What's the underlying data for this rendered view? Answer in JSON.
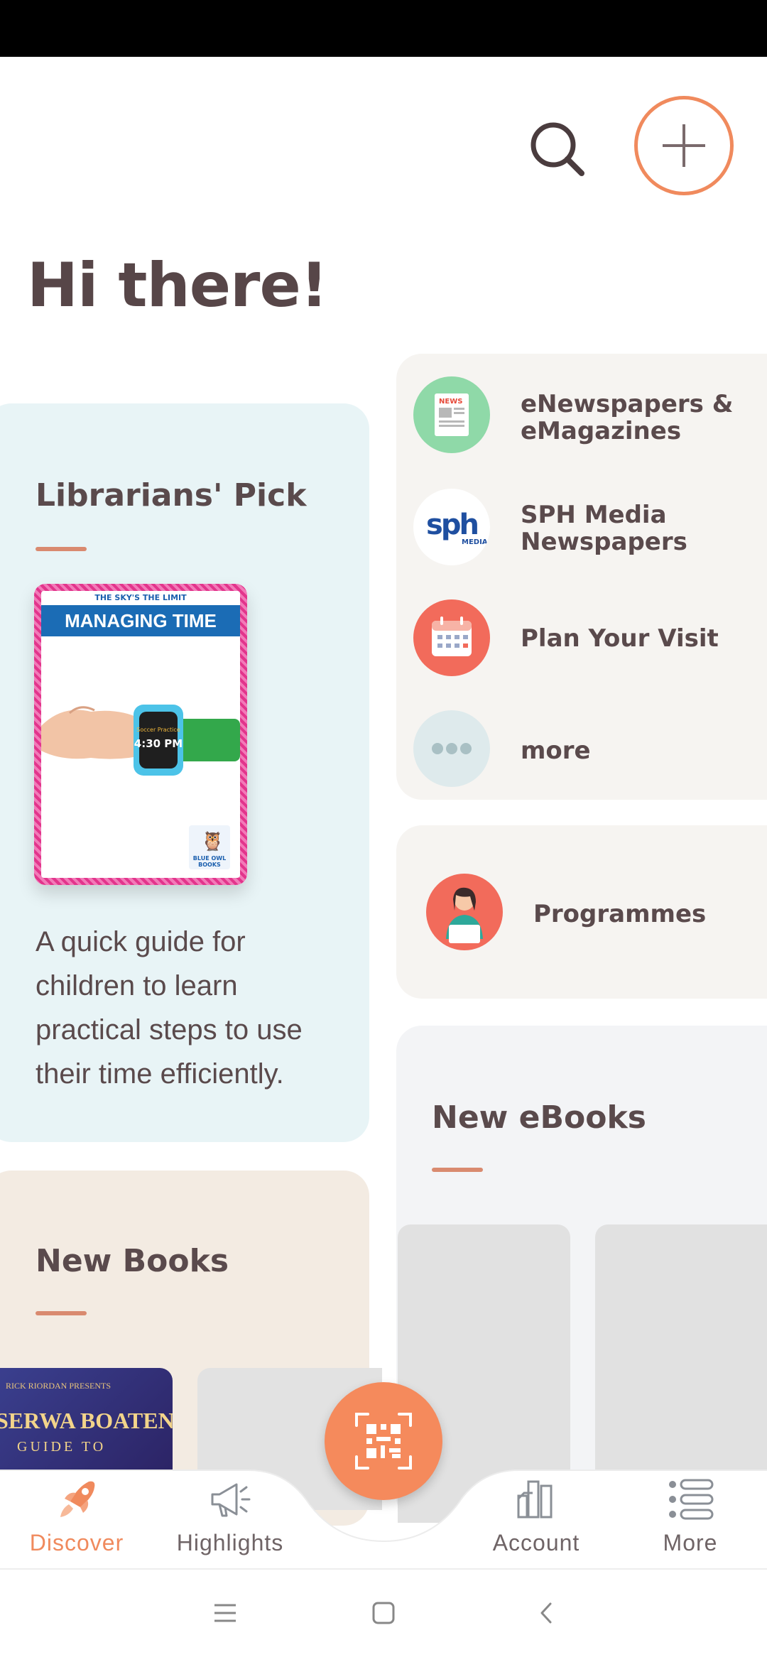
{
  "header": {
    "greeting": "Hi there!"
  },
  "librarians_pick": {
    "title": "Librarians' Pick",
    "book": {
      "tagline": "THE SKY'S THE LIMIT",
      "title": "MANAGING TIME",
      "watch_text": "4:30 PM",
      "publisher": "BLUE OWL BOOKS"
    },
    "description": "A quick guide for children to learn practical steps to use their time efficiently."
  },
  "new_books": {
    "title": "New Books",
    "book1": {
      "presenter": "RICK RIORDAN PRESENTS",
      "title": "SERWA BOATENG'S",
      "subtitle": "GUIDE TO"
    }
  },
  "quick_links": [
    {
      "label": "eNewspapers & eMagazines",
      "icon": "newspaper-icon",
      "color": "#8fd9a8"
    },
    {
      "label": "SPH Media Newspapers",
      "icon": "sph-logo-icon",
      "color": "#ffffff"
    },
    {
      "label": "Plan Your Visit",
      "icon": "calendar-icon",
      "color": "#f26b5b"
    },
    {
      "label": "more",
      "icon": "more-dots-icon",
      "color": "#deeaec"
    }
  ],
  "programmes": {
    "label": "Programmes",
    "icon": "presenter-icon",
    "color": "#f26b5b"
  },
  "new_ebooks": {
    "title": "New eBooks"
  },
  "bottom_nav": {
    "items": [
      {
        "label": "Discover",
        "icon": "rocket-icon",
        "active": true
      },
      {
        "label": "Highlights",
        "icon": "megaphone-icon",
        "active": false
      },
      {
        "label": "Account",
        "icon": "books-icon",
        "active": false
      },
      {
        "label": "More",
        "icon": "list-icon",
        "active": false
      }
    ],
    "fab_icon": "qr-scan-icon"
  },
  "colors": {
    "accent": "#f08a5d",
    "text": "#5a4a4c",
    "lib_card": "#e8f4f6",
    "books_card": "#f3ebe2",
    "links_card": "#f6f4f1"
  }
}
